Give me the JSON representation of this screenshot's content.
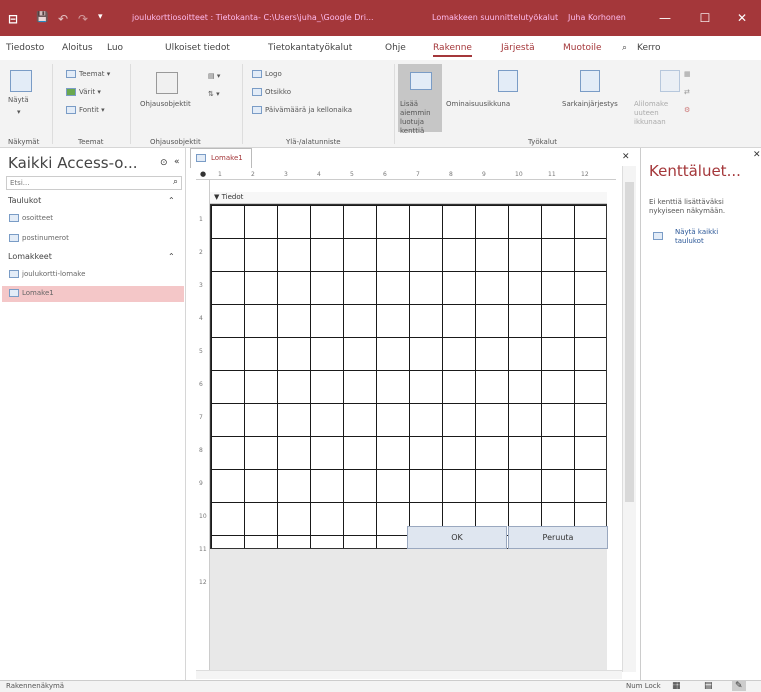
{
  "titlebar": {
    "title": "joulukorttiosoitteet : Tietokanta- C:\\Users\\juha_\\Google Dri...",
    "context_tools": "Lomakkeen suunnittelutyökalut",
    "user": "Juha Korhonen",
    "minimize": "—",
    "restore": "☐",
    "close": "✕",
    "app_icon": "access-app-icon",
    "save_glyph": "💾",
    "undo_glyph": "↶",
    "redo_glyph": "↷",
    "qat_glyph": "▾"
  },
  "tabs": [
    "Tiedosto",
    "Aloitus",
    "Luo",
    "Ulkoiset tiedot",
    "Tietokantatyökalut",
    "Ohje",
    "Rakenne",
    "Järjestä",
    "Muotoile"
  ],
  "tell_me": "Kerro",
  "ribbon": {
    "view": "Näytä",
    "view_group": "Näkymät",
    "themes": "Teemat ▾",
    "colors": "Värit ▾",
    "fonts": "Fontit ▾",
    "themes_group": "Teemat",
    "controls": "Ohjausobjektit",
    "controls_group": "Ohjausobjektit",
    "logo": "Logo",
    "title": "Otsikko",
    "datetime": "Päivämäärä ja kellonaika",
    "header_group": "Ylä-/alatunniste",
    "add_fields": "Lisää aiemmin luotuja kenttiä",
    "property_sheet": "Ominaisuusikkuna",
    "tab_order": "Sarkainjärjestys",
    "subform": "Alilomake uuteen ikkunaan",
    "tools_group": "Työkalut"
  },
  "nav": {
    "title": "Kaikki Access-o...",
    "search_placeholder": "Etsi...",
    "search_icon_glyph": "⌕",
    "tables_header": "Taulukot",
    "tables": [
      "osoitteet",
      "postinumerot"
    ],
    "forms_header": "Lomakkeet",
    "forms": [
      "joulukortti-lomake",
      "Lomake1"
    ],
    "collapse_glyph": "«",
    "menu_glyph": "⊙",
    "caret_glyph": "⌃"
  },
  "document": {
    "tab_label": "Lomake1",
    "section_label": "Tiedot",
    "close_glyph": "✕",
    "ok_label": "OK",
    "cancel_label": "Peruuta",
    "ruler_marks": [
      "1",
      "2",
      "3",
      "4",
      "5",
      "6",
      "7",
      "8",
      "9",
      "10",
      "11",
      "12"
    ]
  },
  "fieldlist": {
    "title": "Kenttäluet...",
    "info": "Ei kenttiä lisättäväksi nykyiseen näkymään.",
    "show_all": "Näytä kaikki taulukot",
    "close_glyph": "✕"
  },
  "statusbar": {
    "mode": "Rakennenäkymä",
    "numlock": "Num Lock"
  },
  "colors": {
    "accent": "#a4373a",
    "selected_row": "#f4c7c8"
  }
}
